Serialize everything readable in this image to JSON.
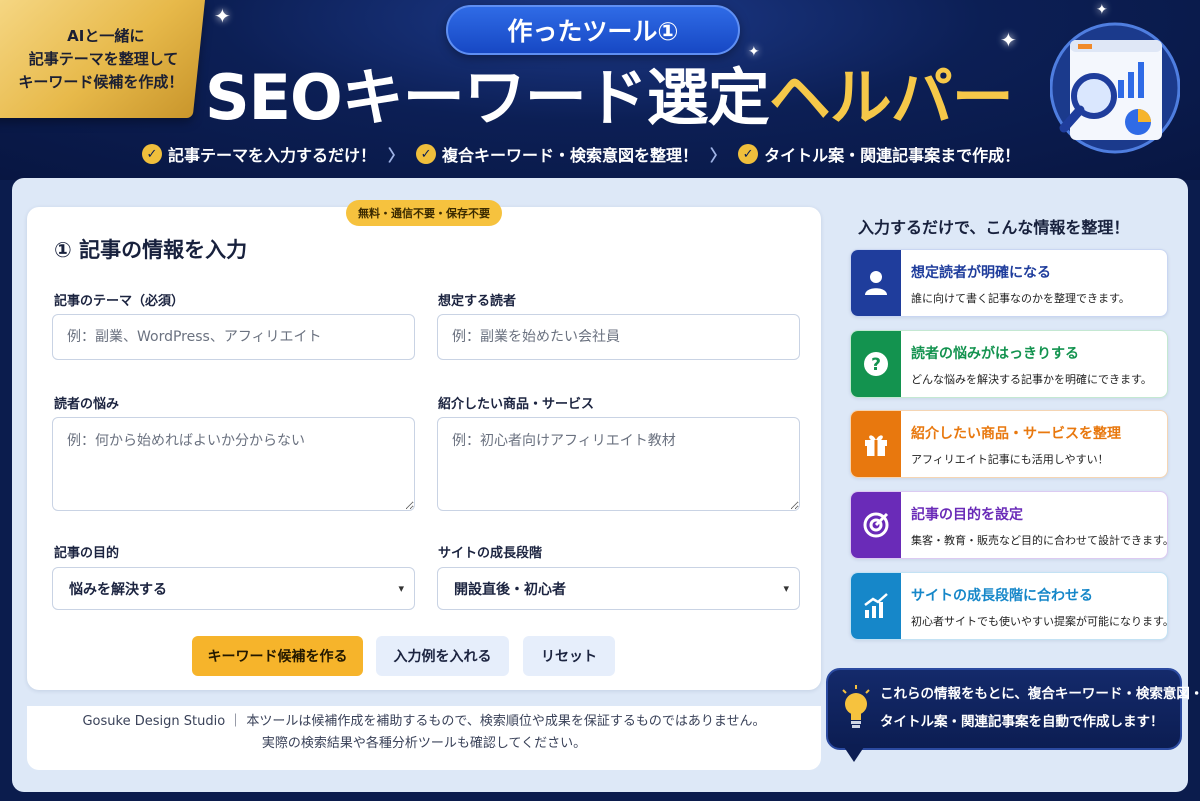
{
  "hero": {
    "ribbon_lines": [
      "AIと一緒に",
      "記事テーマを整理して",
      "キーワード候補を作成！"
    ],
    "tool_label": "作ったツール①",
    "title_white": "SEOキーワード選定",
    "title_gold": "ヘルパー",
    "checks": [
      "記事テーマを入力するだけ！",
      "複合キーワード・検索意図を整理！",
      "タイトル案・関連記事案まで作成！"
    ]
  },
  "form": {
    "badge": "無料・通信不要・保存不要",
    "section_title": "① 記事の情報を入力",
    "theme_label": "記事のテーマ（必須）",
    "theme_placeholder": "例：副業、WordPress、アフィリエイト",
    "reader_label": "想定する読者",
    "reader_placeholder": "例：副業を始めたい会社員",
    "worry_label": "読者の悩み",
    "worry_placeholder": "例：何から始めればよいか分からない",
    "product_label": "紹介したい商品・サービス",
    "product_placeholder": "例：初心者向けアフィリエイト教材",
    "purpose_label": "記事の目的",
    "purpose_value": "悩みを解決する",
    "stage_label": "サイトの成長段階",
    "stage_value": "開設直後・初心者",
    "btn_generate": "キーワード候補を作る",
    "btn_example": "入力例を入れる",
    "btn_reset": "リセット"
  },
  "footer": {
    "line1": "Gosuke Design Studio ｜ 本ツールは候補作成を補助するもので、検索順位や成果を保証するものではありません。",
    "line2": "実際の検索結果や各種分析ツールも確認してください。"
  },
  "side": {
    "heading": "入力するだけで、こんな情報を整理！",
    "features": [
      {
        "title": "想定読者が明確になる",
        "desc": "誰に向けて書く記事なのかを整理できます。",
        "color": "#1f3d9c",
        "icon": "person-icon"
      },
      {
        "title": "読者の悩みがはっきりする",
        "desc": "どんな悩みを解決する記事かを明確にできます。",
        "color": "#13934f",
        "icon": "question-icon"
      },
      {
        "title": "紹介したい商品・サービスを整理",
        "desc": "アフィリエイト記事にも活用しやすい！",
        "color": "#e8780e",
        "icon": "gift-icon"
      },
      {
        "title": "記事の目的を設定",
        "desc": "集客・教育・販売など目的に合わせて設計できます。",
        "color": "#6a2bb8",
        "icon": "target-icon"
      },
      {
        "title": "サイトの成長段階に合わせる",
        "desc": "初心者サイトでも使いやすい提案が可能になります。",
        "color": "#1687c9",
        "icon": "growth-chart-icon"
      }
    ],
    "bubble_line1": "これらの情報をもとに、複合キーワード・検索意図・",
    "bubble_line2": "タイトル案・関連記事案を自動で作成します！"
  }
}
